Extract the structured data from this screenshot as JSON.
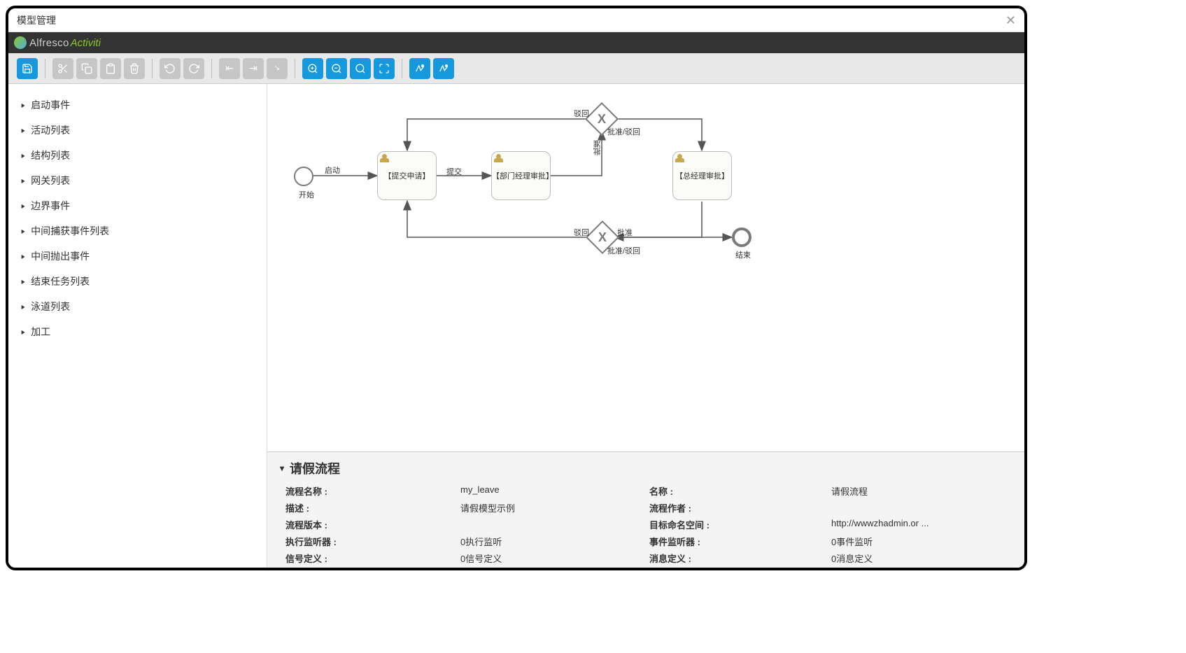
{
  "window": {
    "title": "模型管理"
  },
  "brand": {
    "alfresco": "Alfresco",
    "activiti": "Activiti"
  },
  "sidebar": [
    "启动事件",
    "活动列表",
    "结构列表",
    "网关列表",
    "边界事件",
    "中间捕获事件列表",
    "中间抛出事件",
    "结束任务列表",
    "泳道列表",
    "加工"
  ],
  "diagram": {
    "start_label": "开始",
    "seq_start": "启动",
    "task_submit": "【提交申请】",
    "seq_submit": "提交",
    "task_dept": "【部门经理审批】",
    "gw1_label": "批准/驳回",
    "gw1_reject": "驳回",
    "gw1_approve": "批准",
    "task_gm": "【总经理审批】",
    "gw2_label": "批准/驳回",
    "gw2_reject": "驳回",
    "gw2_approve": "批准",
    "end_label": "结束"
  },
  "props": {
    "title": "请假流程",
    "rows": [
      {
        "l1": "流程名称 :",
        "v1": "my_leave",
        "l2": "名称 :",
        "v2": "请假流程"
      },
      {
        "l1": "描述 :",
        "v1": "请假模型示例",
        "l2": "流程作者 :",
        "v2": ""
      },
      {
        "l1": "流程版本 :",
        "v1": "",
        "l2": "目标命名空间 :",
        "v2": "http://wwwzhadmin.or ..."
      },
      {
        "l1": "执行监听器 :",
        "v1": "0执行监听",
        "l2": "事件监听器 :",
        "v2": "0事件监听"
      },
      {
        "l1": "信号定义 :",
        "v1": "0信号定义",
        "l2": "消息定义 :",
        "v2": "0消息定义"
      }
    ]
  }
}
